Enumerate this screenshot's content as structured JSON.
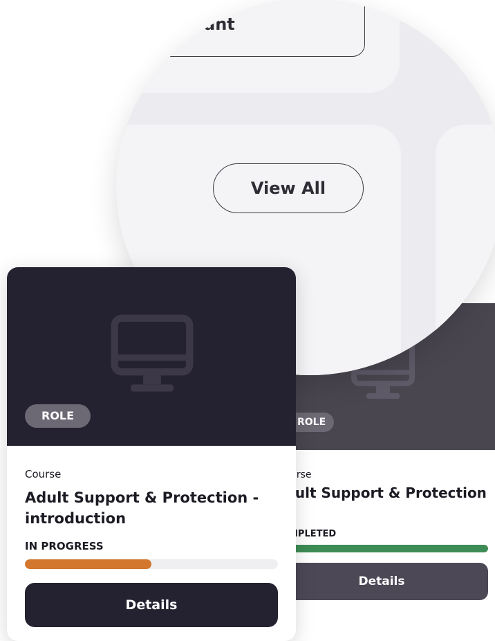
{
  "colors": {
    "banner_dark": "#242130",
    "banner_muted": "#4a4650",
    "badge": "#6c6874",
    "progress_in_progress": "#d2772d",
    "progress_completed": "#3d8c55",
    "track": "#efeff2",
    "button_dark": "#242130",
    "button_muted": "#4c4856"
  },
  "zoom": {
    "partial_button_label": "ant",
    "view_all_label": "View All"
  },
  "cards": [
    {
      "banner_icon": "monitor-icon",
      "badge": "ROLE",
      "kind": "Course",
      "title": "Adult Support & Protection - introduction",
      "status": "IN PROGRESS",
      "progress": 0.5,
      "details_label": "Details"
    },
    {
      "banner_icon": "monitor-icon",
      "badge": "ROLE",
      "kind": "urse",
      "title": "lult Support & Protection",
      "status": "MPLETED",
      "progress": 1.0,
      "details_label": "Details"
    }
  ]
}
